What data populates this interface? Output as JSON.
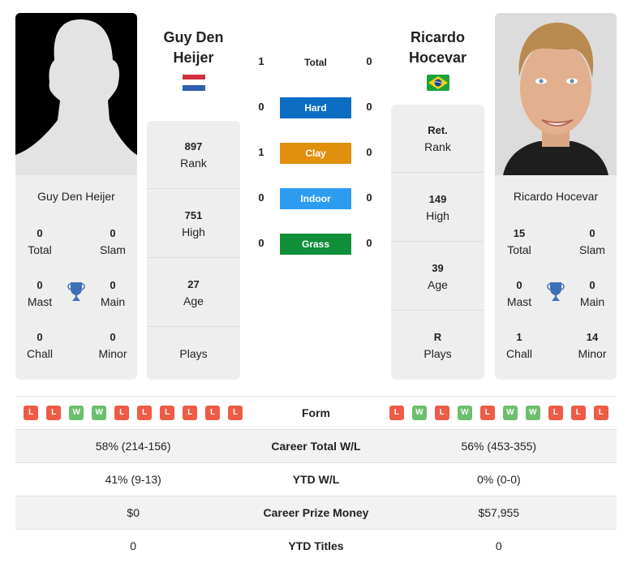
{
  "colors": {
    "hard": "#0b6cc2",
    "clay": "#e0900c",
    "indoor": "#2d9cf0",
    "grass": "#0f8f3a",
    "win": "#6cbf6c",
    "loss": "#ef5b45",
    "trophy": "#3f6fb8"
  },
  "player1": {
    "name": "Guy Den Heijer",
    "name_line1": "Guy Den",
    "name_line2": "Heijer",
    "flag": "netherlands-flag",
    "titles": {
      "total": "0",
      "total_label": "Total",
      "slam": "0",
      "slam_label": "Slam",
      "mast": "0",
      "mast_label": "Mast",
      "main": "0",
      "main_label": "Main",
      "chall": "0",
      "chall_label": "Chall",
      "minor": "0",
      "minor_label": "Minor"
    },
    "info": [
      {
        "value": "897",
        "label": "Rank"
      },
      {
        "value": "751",
        "label": "High"
      },
      {
        "value": "27",
        "label": "Age"
      },
      {
        "value": "",
        "label": "Plays"
      }
    ],
    "form": [
      "L",
      "L",
      "W",
      "W",
      "L",
      "L",
      "L",
      "L",
      "L",
      "L"
    ],
    "career_wl": "58% (214-156)",
    "ytd_wl": "41% (9-13)",
    "prize": "$0",
    "ytd_titles": "0"
  },
  "player2": {
    "name": "Ricardo Hocevar",
    "name_line1": "Ricardo",
    "name_line2": "Hocevar",
    "flag": "brazil-flag",
    "titles": {
      "total": "15",
      "total_label": "Total",
      "slam": "0",
      "slam_label": "Slam",
      "mast": "0",
      "mast_label": "Mast",
      "main": "0",
      "main_label": "Main",
      "chall": "1",
      "chall_label": "Chall",
      "minor": "14",
      "minor_label": "Minor"
    },
    "info": [
      {
        "value": "Ret.",
        "label": "Rank"
      },
      {
        "value": "149",
        "label": "High"
      },
      {
        "value": "39",
        "label": "Age"
      },
      {
        "value": "R",
        "label": "Plays"
      }
    ],
    "form": [
      "L",
      "W",
      "L",
      "W",
      "L",
      "W",
      "W",
      "L",
      "L",
      "L"
    ],
    "career_wl": "56% (453-355)",
    "ytd_wl": "0% (0-0)",
    "prize": "$57,955",
    "ytd_titles": "0"
  },
  "h2h": {
    "total_label": "Total",
    "total": [
      "1",
      "0"
    ],
    "surfaces": [
      {
        "label": "Hard",
        "p1": "0",
        "p2": "0"
      },
      {
        "label": "Clay",
        "p1": "1",
        "p2": "0"
      },
      {
        "label": "Indoor",
        "p1": "0",
        "p2": "0"
      },
      {
        "label": "Grass",
        "p1": "0",
        "p2": "0"
      }
    ]
  },
  "comparison": {
    "form_label": "Form",
    "career_wl_label": "Career Total W/L",
    "ytd_wl_label": "YTD W/L",
    "prize_label": "Career Prize Money",
    "ytd_titles_label": "YTD Titles"
  }
}
